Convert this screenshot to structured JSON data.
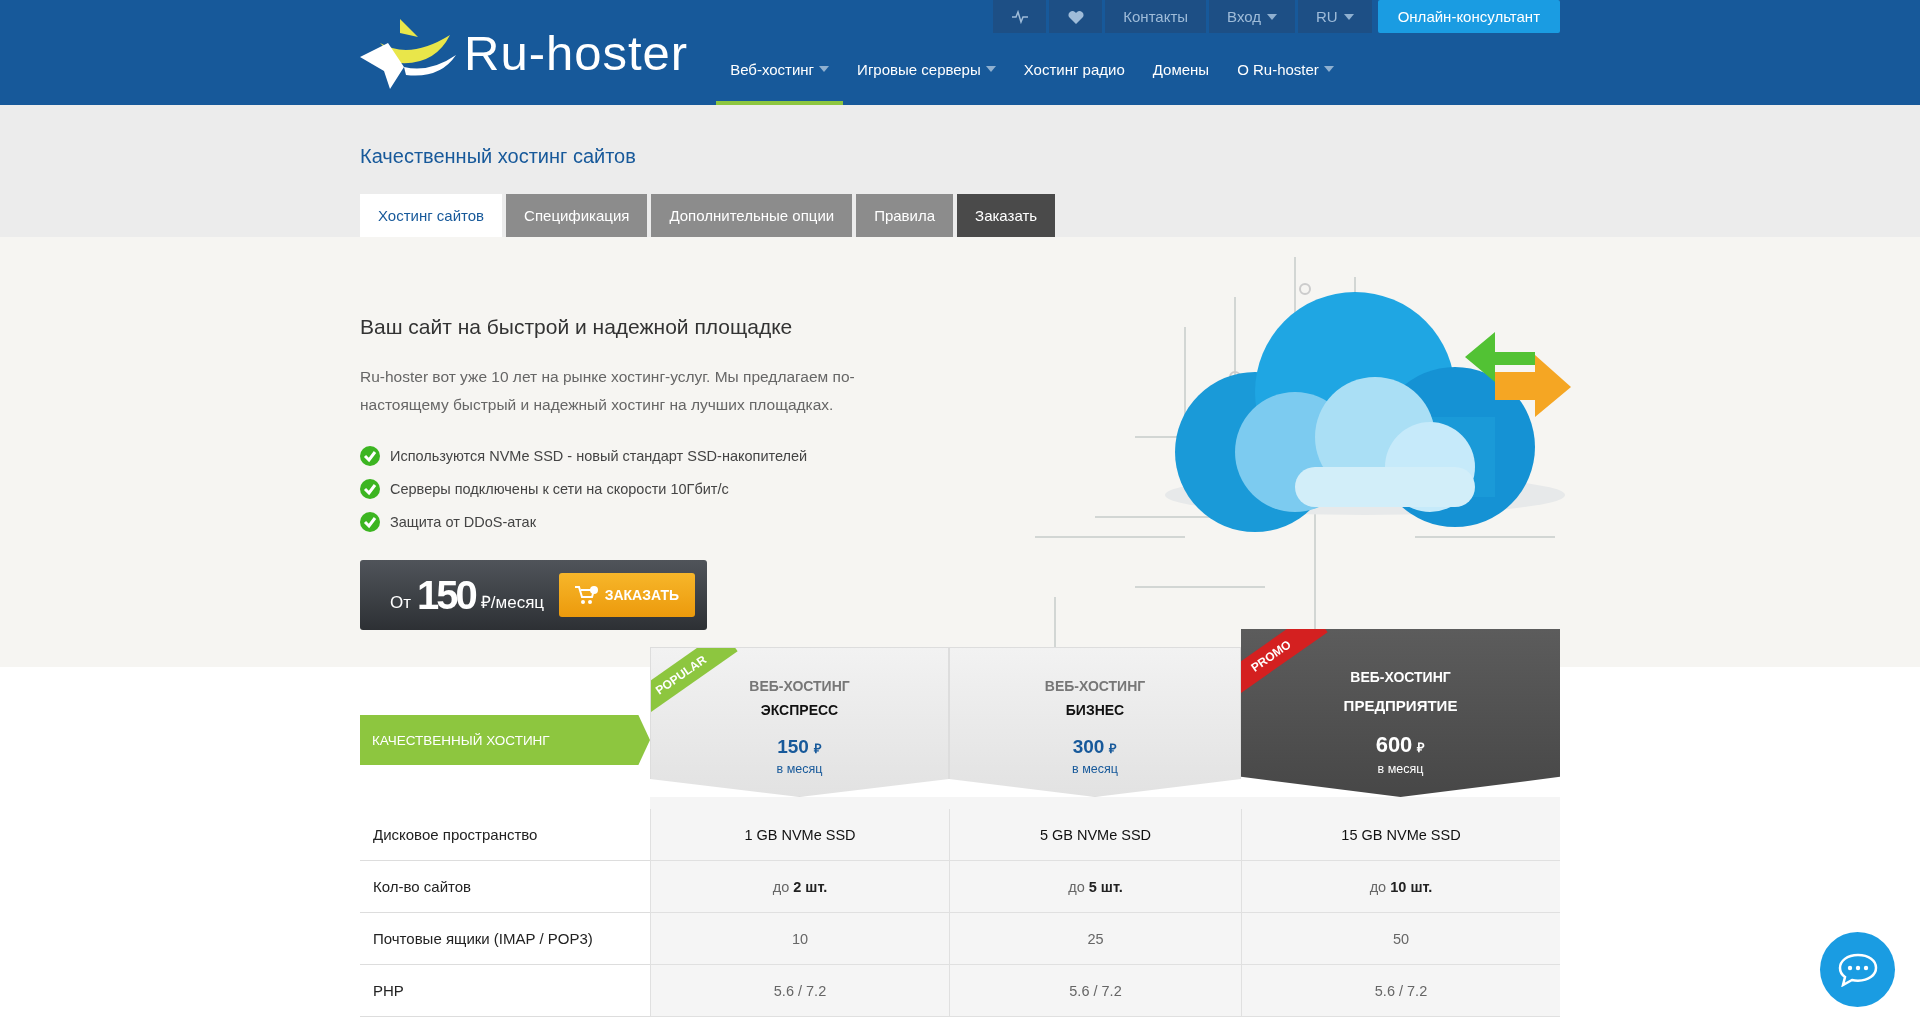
{
  "header": {
    "logo_text": "Ru-hoster",
    "top_bar": [
      {
        "label": "Контакты",
        "dropdown": false
      },
      {
        "label": "Вход",
        "dropdown": true
      },
      {
        "label": "RU",
        "dropdown": true
      }
    ],
    "consultant_button": "Онлайн-консультант",
    "nav": [
      {
        "label": "Веб-хостинг",
        "dropdown": true,
        "selected": true
      },
      {
        "label": "Игровые серверы",
        "dropdown": true,
        "selected": false
      },
      {
        "label": "Хостинг радио",
        "dropdown": false,
        "selected": false
      },
      {
        "label": "Домены",
        "dropdown": false,
        "selected": false
      },
      {
        "label": "О Ru-hoster",
        "dropdown": true,
        "selected": false
      }
    ]
  },
  "page_title": "Качественный хостинг сайтов",
  "tabs": [
    {
      "label": "Хостинг сайтов",
      "selected": true,
      "kind": "normal"
    },
    {
      "label": "Спецификация",
      "selected": false,
      "kind": "normal"
    },
    {
      "label": "Дополнительные опции",
      "selected": false,
      "kind": "normal"
    },
    {
      "label": "Правила",
      "selected": false,
      "kind": "normal"
    },
    {
      "label": "Заказать",
      "selected": false,
      "kind": "order"
    }
  ],
  "hero": {
    "heading": "Ваш сайт на быстрой и надежной площадке",
    "paragraph": "Ru-hoster вот уже 10 лет на рынке хостинг-услуг. Мы предлагаем по-настоящему быстрый и надежный хостинг на лучших площадках.",
    "features": [
      "Используются NVMe SSD - новый стандарт SSD-накопителей",
      "Серверы подключены к сети на скорости 10Гбит/с",
      "Защита от DDoS-атак"
    ],
    "price_box": {
      "prefix": "От",
      "amount": "150",
      "unit": "₽/месяц",
      "button": "ЗАКАЗАТЬ"
    }
  },
  "plans": {
    "section_label": "КАЧЕСТВЕННЫЙ ХОСТИНГ",
    "items": [
      {
        "category": "ВЕБ-ХОСТИНГ",
        "name": "ЭКСПРЕСС",
        "price": "150",
        "currency": "₽",
        "period": "в месяц",
        "highlighted": false,
        "ribbon": {
          "text": "POPULAR",
          "color": "#8dc63f"
        }
      },
      {
        "category": "ВЕБ-ХОСТИНГ",
        "name": "БИЗНЕС",
        "price": "300",
        "currency": "₽",
        "period": "в месяц",
        "highlighted": false
      },
      {
        "category": "ВЕБ-ХОСТИНГ",
        "name": "ПРЕДПРИЯТИЕ",
        "price": "600",
        "currency": "₽",
        "period": "в месяц",
        "highlighted": true,
        "ribbon": {
          "text": "PROMO",
          "color": "#d42020"
        }
      }
    ],
    "rows": [
      {
        "label": "Дисковое пространство",
        "values": [
          "1 GB NVMe SSD",
          "5 GB NVMe SSD",
          "15 GB NVMe SSD"
        ],
        "strong": true
      },
      {
        "label": "Кол-во сайтов",
        "values": [
          "до **2 шт.**",
          "до **5 шт.**",
          "до **10 шт.**"
        ],
        "strong": false
      },
      {
        "label": "Почтовые ящики (IMAP / POP3)",
        "values": [
          "10",
          "25",
          "50"
        ],
        "strong": false
      },
      {
        "label": "PHP",
        "values": [
          "5.6 / 7.2",
          "5.6 / 7.2",
          "5.6 / 7.2"
        ],
        "strong": false
      }
    ]
  }
}
